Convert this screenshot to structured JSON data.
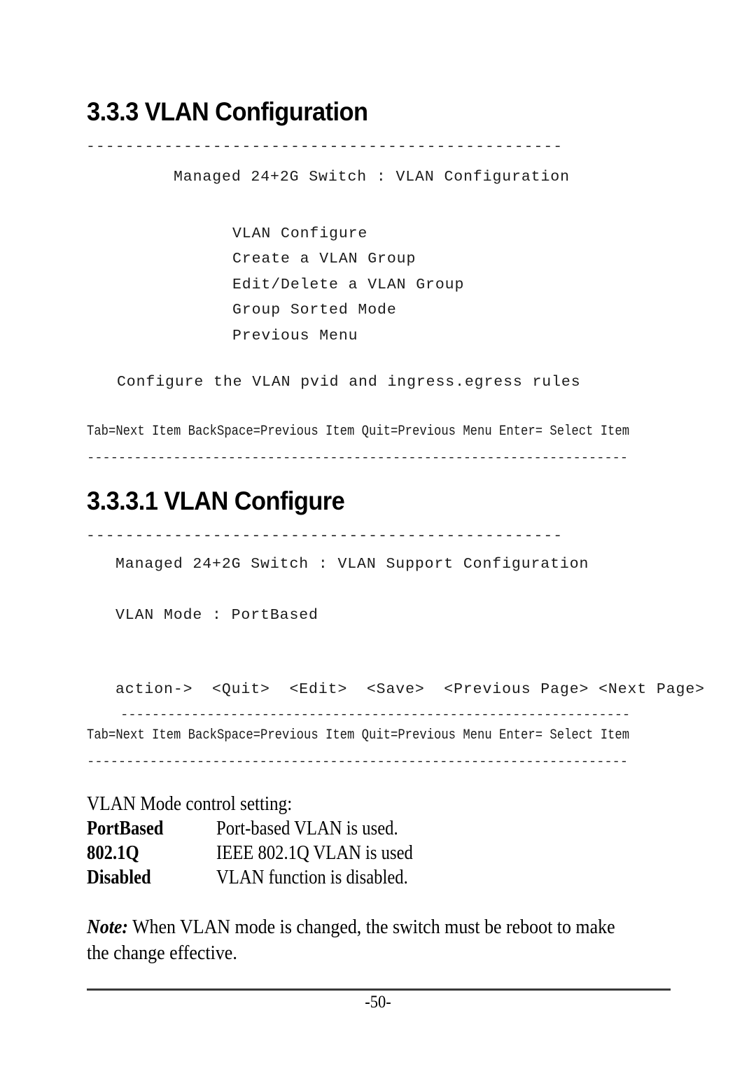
{
  "document": {
    "page_number": "-50-"
  },
  "section1": {
    "heading": "3.3.3 VLAN Configuration",
    "rule_top": "-------------------------------------------------",
    "title": "Managed 24+2G Switch : VLAN Configuration",
    "menu_items": [
      "VLAN Configure",
      "Create a VLAN Group",
      "Edit/Delete a VLAN Group",
      "Group Sorted Mode",
      "Previous Menu"
    ],
    "description": "Configure the VLAN pvid and ingress.egress rules",
    "help_line": "Tab=Next Item BackSpace=Previous Item Quit=Previous Menu Enter= Select Item",
    "rule_bottom": "---------------------------------------------------------------------"
  },
  "section2": {
    "heading": "3.3.3.1 VLAN Configure",
    "rule_top": "-------------------------------------------------",
    "title": "Managed 24+2G Switch : VLAN Support Configuration",
    "mode_line": "VLAN Mode : PortBased",
    "mode_label": "VLAN Mode",
    "mode_value": "PortBased",
    "action_prefix": "action->",
    "actions": [
      "<Quit>",
      "<Edit>",
      "<Save>",
      "<Previous Page>",
      "<Next Page>"
    ],
    "action_line": "action->  <Quit>  <Edit>  <Save>  <Previous Page> <Next Page>",
    "rule_mid": "-----------------------------------------------------------------",
    "help_line": "Tab=Next Item BackSpace=Previous Item Quit=Previous Menu Enter= Select Item",
    "rule_bottom": "---------------------------------------------------------------------"
  },
  "mode_settings": {
    "intro": "VLAN Mode control setting:",
    "rows": [
      {
        "term": "PortBased",
        "desc": "Port-based VLAN is used."
      },
      {
        "term": "802.1Q",
        "desc": "IEEE 802.1Q VLAN is used"
      },
      {
        "term": "Disabled",
        "desc": "VLAN function is disabled."
      }
    ]
  },
  "note": {
    "label": "Note:",
    "line1": " When VLAN mode is changed, the switch must be reboot to make",
    "line2": "the change effective."
  }
}
